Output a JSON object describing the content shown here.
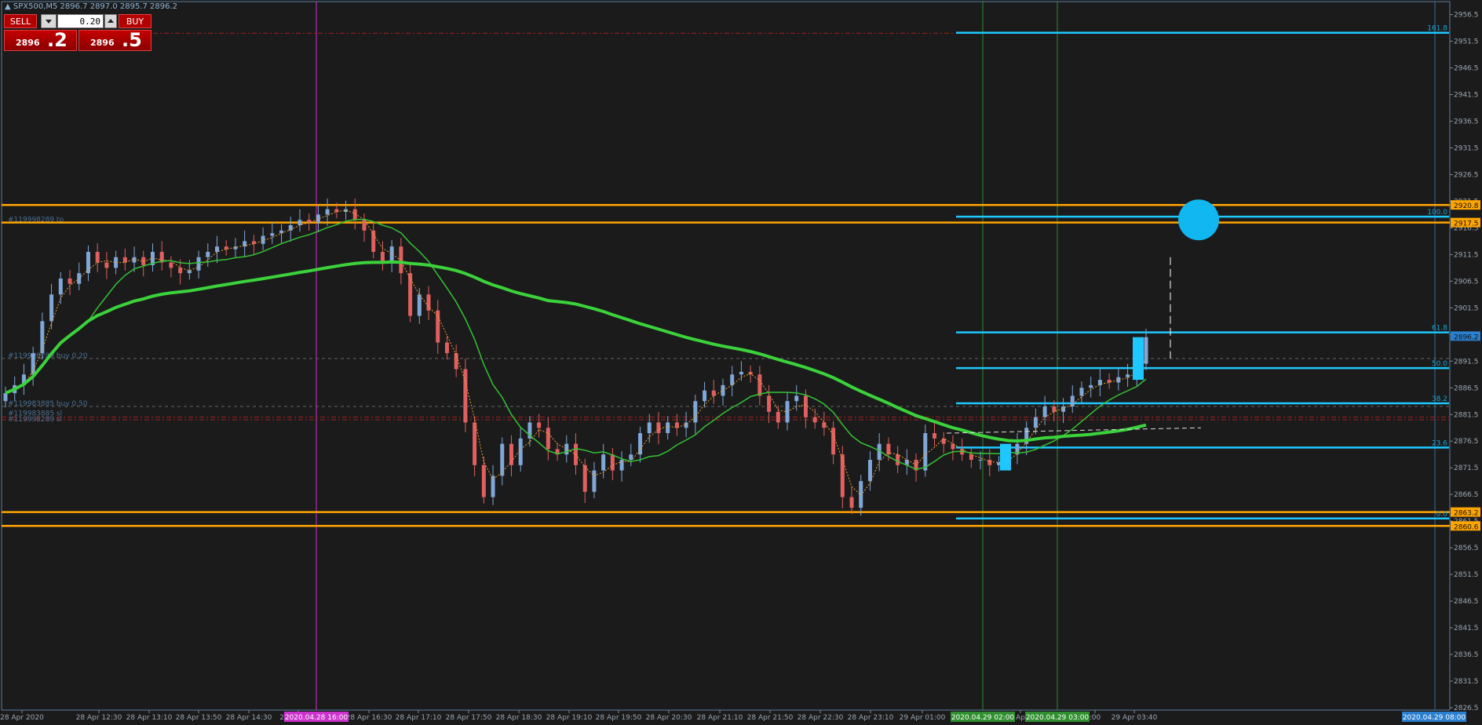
{
  "header": {
    "symbol_label": "▲ SPX500,M5  2896.7 2897.0 2895.7 2896.2"
  },
  "trade_panel": {
    "sell_label": "SELL",
    "buy_label": "BUY",
    "lot_value": "0.20",
    "bid_big": "2896",
    "bid_points": ".2",
    "ask_big": "2896",
    "ask_points": ".5"
  },
  "colors": {
    "background": "#1b1b1b",
    "bull_candle": "#7fa7d8",
    "bear_candle": "#e06060",
    "level_line": "#ffa500",
    "fibo_line": "#1ec8ff",
    "ma_slow": "#3bd23b",
    "ma_fast": "#34c234",
    "ma_dotted": "#e8a030",
    "vline_magenta": "#cc33cc",
    "vline_green": "#2f8f2f"
  },
  "price_axis": {
    "labels": [
      "2956.5",
      "2951.5",
      "2946.5",
      "2941.5",
      "2936.5",
      "2931.5",
      "2926.5",
      "2921.5",
      "2916.5",
      "2911.5",
      "2906.5",
      "2901.5",
      "2896.5",
      "2891.5",
      "2886.5",
      "2881.5",
      "2876.5",
      "2871.5",
      "2866.5",
      "2861.5",
      "2856.5",
      "2851.5",
      "2846.5",
      "2841.5",
      "2836.5",
      "2831.5",
      "2826.5"
    ],
    "level_tags": [
      {
        "text": "2920.8",
        "color": "#ffa500",
        "price": 2920.8
      },
      {
        "text": "2917.5",
        "color": "#ffa500",
        "price": 2917.5
      },
      {
        "text": "2896.2",
        "color": "#2a7fcf",
        "price": 2896.2
      },
      {
        "text": "2863.2",
        "color": "#ffa500",
        "price": 2863.2
      },
      {
        "text": "2860.6",
        "color": "#ffa500",
        "price": 2860.6
      }
    ]
  },
  "time_axis": {
    "labels": [
      "28 Apr 2020",
      "28 Apr 12:30",
      "28 Apr 13:10",
      "28 Apr 13:50",
      "28 Apr 14:30",
      "28 Apr 15:",
      "28 Apr 16:30",
      "28 Apr 17:10",
      "28 Apr 17:50",
      "28 Apr 18:30",
      "28 Apr 19:10",
      "28 Apr 19:50",
      "28 Apr 20:30",
      "28 Apr 21:10",
      "28 Apr 21:50",
      "28 Apr 22:30",
      "28 Apr 23:10",
      "29 Apr 01:00",
      "Ap",
      ":00",
      "29 Apr 03:40"
    ],
    "highlights": [
      {
        "text": "2020.04.28 16:00",
        "bg": "#cc33cc"
      },
      {
        "text": "2020.04.29 02:00",
        "bg": "#2f8f2f"
      },
      {
        "text": "2020.04.29 03:00",
        "bg": "#2f8f2f"
      },
      {
        "text": "2020.04.29 08:00",
        "bg": "#2a7fcf"
      }
    ]
  },
  "order_labels": {
    "tp": "#119998289 tp",
    "buy1": "#119998289 buy 0.20",
    "buy2": "#119983885 buy 0.50",
    "sl1": "#119983885 sl",
    "sl2": "#119998289 sl"
  },
  "fibo_labels": [
    "161.8",
    "100.0",
    "61.8",
    "50.0",
    "38.2",
    "23.6",
    "0.0"
  ],
  "chart_data": {
    "type": "candlestick",
    "symbol": "SPX500",
    "timeframe": "M5",
    "ylim": [
      2826.5,
      2958.5
    ],
    "levels": [
      2920.8,
      2917.5,
      2863.2,
      2860.6
    ],
    "fibo_levels": [
      {
        "label": "161.8",
        "price": 2953.1
      },
      {
        "label": "100.0",
        "price": 2918.6
      },
      {
        "label": "61.8",
        "price": 2896.9
      },
      {
        "label": "50.0",
        "price": 2890.2
      },
      {
        "label": "38.2",
        "price": 2883.6
      },
      {
        "label": "23.6",
        "price": 2875.3
      },
      {
        "label": "0.0",
        "price": 2862.0
      }
    ],
    "order_lines": [
      {
        "price": 2917.5,
        "label": "tp"
      },
      {
        "price": 2892.0,
        "label": "buy1"
      },
      {
        "price": 2883.0,
        "label": "buy2"
      },
      {
        "price": 2881.0,
        "label": "sl"
      },
      {
        "price": 2880.5,
        "label": "sl"
      }
    ],
    "candles_close": [
      2885.5,
      2887.0,
      2889.0,
      2893.0,
      2899.0,
      2904.0,
      2907.0,
      2906.0,
      2908.0,
      2912.0,
      2910.0,
      2909.0,
      2911.0,
      2910.0,
      2911.0,
      2909.5,
      2912.0,
      2910.0,
      2909.0,
      2908.0,
      2908.5,
      2911.0,
      2912.0,
      2913.0,
      2912.5,
      2913.0,
      2914.0,
      2913.5,
      2915.0,
      2915.5,
      2916.0,
      2917.0,
      2918.0,
      2917.5,
      2919.0,
      2920.0,
      2919.5,
      2920.0,
      2918.0,
      2916.0,
      2912.0,
      2910.0,
      2913.0,
      2908.0,
      2900.0,
      2904.0,
      2901.0,
      2895.0,
      2893.0,
      2890.0,
      2880.0,
      2872.0,
      2866.0,
      2870.0,
      2876.0,
      2872.0,
      2877.0,
      2880.0,
      2879.0,
      2875.0,
      2874.0,
      2876.0,
      2872.0,
      2867.0,
      2871.0,
      2874.0,
      2871.0,
      2873.0,
      2874.0,
      2878.0,
      2880.0,
      2878.0,
      2880.0,
      2879.0,
      2880.0,
      2884.0,
      2886.0,
      2885.0,
      2887.0,
      2889.0,
      2889.5,
      2889.0,
      2885.0,
      2882.0,
      2880.0,
      2884.0,
      2885.0,
      2881.0,
      2880.0,
      2879.0,
      2874.0,
      2866.0,
      2864.0,
      2869.0,
      2873.0,
      2876.0,
      2874.0,
      2872.0,
      2873.0,
      2871.0,
      2878.0,
      2877.0,
      2876.0,
      2875.0,
      2874.0,
      2873.0,
      2873.0,
      2872.0,
      2872.5,
      2874.0,
      2876.0,
      2879.0,
      2881.0,
      2883.0,
      2882.0,
      2883.0,
      2885.0,
      2886.5,
      2887.0,
      2888.0,
      2887.5,
      2888.5,
      2889.0,
      2891.0,
      2896.0
    ],
    "vertical_markers": [
      "2020.04.28 16:00",
      "2020.04.29 02:00",
      "2020.04.29 03:00"
    ],
    "target_circle_price": 2918.0
  }
}
